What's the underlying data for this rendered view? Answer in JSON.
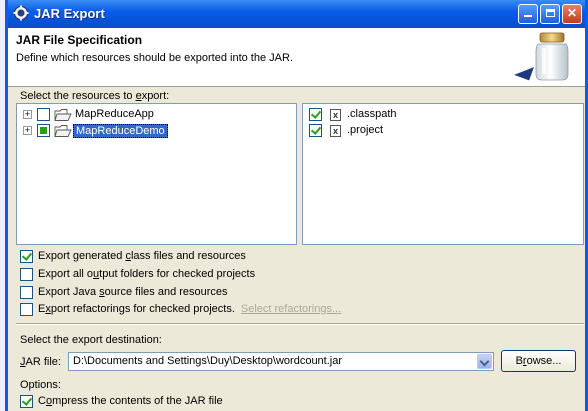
{
  "window": {
    "title": "JAR Export",
    "banner_title": "JAR File Specification",
    "banner_description": "Define which resources should be exported into the JAR.",
    "icons": {
      "title": "eclipse-gear-icon",
      "banner": "jar-icon"
    },
    "colors": {
      "titlebar": "#0a5de8",
      "selection": "#316ac5",
      "check": "#21a121"
    }
  },
  "resources": {
    "label": "Select the resources to export:",
    "tree": [
      {
        "name": "MapReduceApp",
        "checked": "unchecked",
        "selected": false
      },
      {
        "name": "MapReduceDemo",
        "checked": "partial",
        "selected": true
      }
    ],
    "files": [
      {
        "name": ".classpath",
        "checked": true
      },
      {
        "name": ".project",
        "checked": true
      }
    ]
  },
  "options": [
    {
      "label_pre": "Export generated ",
      "label_u": "c",
      "label_post": "lass files and resources",
      "checked": true
    },
    {
      "label_pre": "Export all o",
      "label_u": "u",
      "label_post": "tput folders for checked projects",
      "checked": false
    },
    {
      "label_pre": "Export Java ",
      "label_u": "s",
      "label_post": "ource files and resources",
      "checked": false
    },
    {
      "label_pre": "E",
      "label_u": "x",
      "label_post": "port refactorings for checked projects.",
      "checked": false,
      "link": "Select refactorings..."
    }
  ],
  "destination": {
    "label": "Select the export destination:",
    "jar_label_u": "J",
    "jar_label_rest": "AR file:",
    "jar_path": "D:\\Documents and Settings\\Duy\\Desktop\\wordcount.jar",
    "browse_u": "r",
    "browse_pre": "B",
    "browse_post": "owse..."
  },
  "opts_section": {
    "label": "Options:",
    "compress_u": "o",
    "compress_pre": "C",
    "compress_post": "mpress the contents of the JAR file",
    "compress_checked": true
  }
}
